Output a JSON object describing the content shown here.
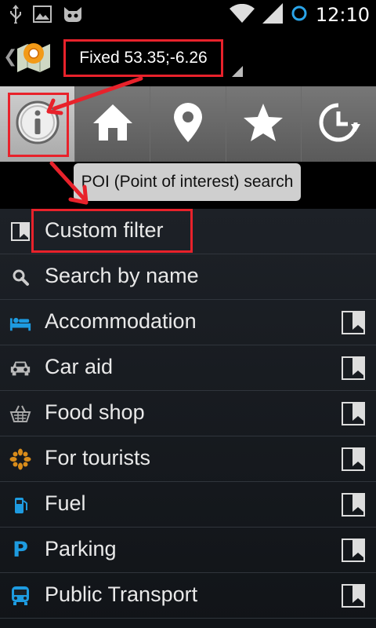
{
  "status_bar": {
    "time": "12:10"
  },
  "action_bar": {
    "title": "Fixed 53.35;-6.26"
  },
  "tabs": [
    {
      "name": "info"
    },
    {
      "name": "home"
    },
    {
      "name": "location"
    },
    {
      "name": "favorites"
    },
    {
      "name": "history"
    }
  ],
  "tooltip": "POI (Point of interest) search",
  "list": {
    "custom_filter": "Custom filter",
    "search_by_name": "Search by name",
    "categories": [
      {
        "label": "Accommodation",
        "icon": "bed-icon"
      },
      {
        "label": "Car aid",
        "icon": "car-icon"
      },
      {
        "label": "Food shop",
        "icon": "basket-icon"
      },
      {
        "label": "For tourists",
        "icon": "tourist-icon"
      },
      {
        "label": "Fuel",
        "icon": "fuel-icon"
      },
      {
        "label": "Parking",
        "icon": "parking-icon",
        "glyph": "P"
      },
      {
        "label": "Public Transport",
        "icon": "bus-icon"
      }
    ]
  },
  "colors": {
    "highlight": "#e8222b",
    "accent_blue": "#1e9be0",
    "tourist_orange": "#d98c1a"
  }
}
